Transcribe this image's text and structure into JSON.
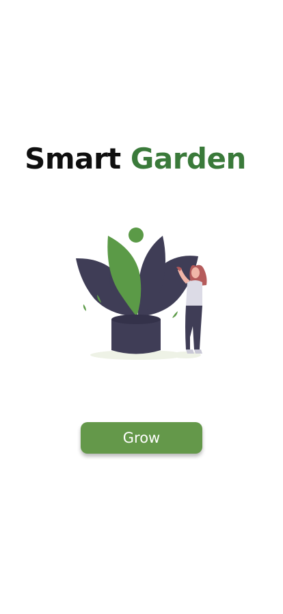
{
  "title": {
    "word1": "Smart",
    "word2": "Garden"
  },
  "illustration": {
    "icon": "woman-watering-plant-icon"
  },
  "actions": {
    "grow_label": "Grow"
  },
  "colors": {
    "brand_green": "#3a7a3a",
    "button_green": "#64984a",
    "leaf_dark": "#3f3d56",
    "leaf_green": "#5b9a47",
    "title_black": "#0f0f0f",
    "background": "#ffffff"
  }
}
